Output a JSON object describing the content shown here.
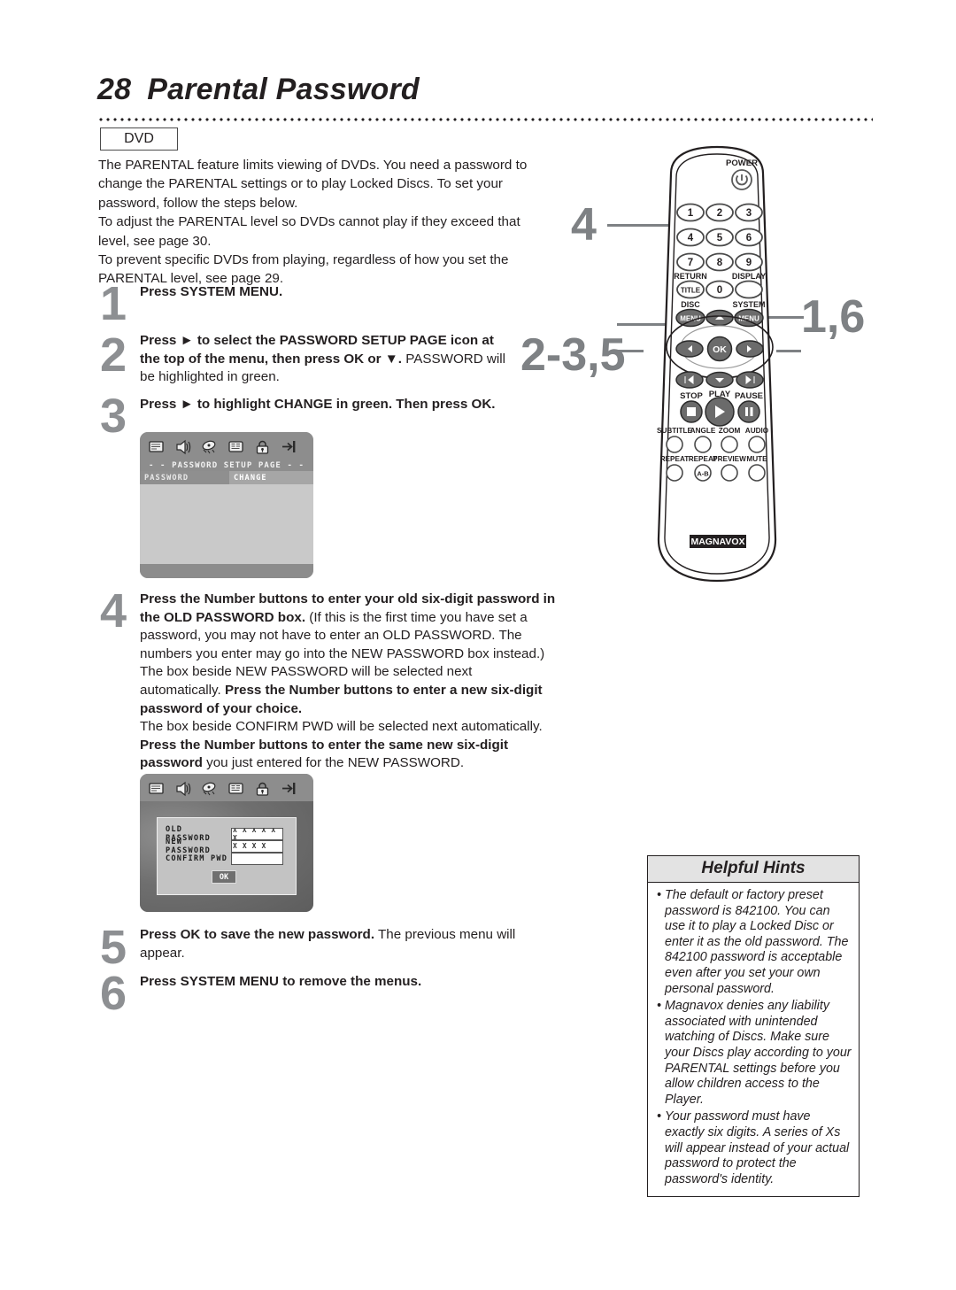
{
  "page": {
    "number": "28",
    "title": "Parental Password",
    "media_badge": "DVD"
  },
  "intro": {
    "p1": "The PARENTAL feature limits viewing of DVDs.  You need a password to change the PARENTAL settings or to play Locked Discs. To set your password, follow the steps below.",
    "p2": "To adjust the PARENTAL level so DVDs cannot play if they exceed that level, see page 30.",
    "p3": "To prevent specific DVDs from playing, regardless of how you set the PARENTAL level, see page 29."
  },
  "steps": [
    {
      "num": "1",
      "html": "<b>Press SYSTEM MENU.</b>"
    },
    {
      "num": "2",
      "html": "<b>Press &#9658; to select the PASSWORD SETUP PAGE icon at the top of the menu, then press OK or &#9660;.</b> PASSWORD will be highlighted in green."
    },
    {
      "num": "3",
      "html": "<b>Press &#9658; to highlight CHANGE in green. Then press OK.</b>"
    },
    {
      "num": "4",
      "html": "<b>Press the Number buttons to enter your old six-digit password in the OLD PASSWORD box.</b> (If this is the first time you have set a password, you may not have to enter an OLD PASSWORD. The numbers you enter may go into the NEW PASSWORD box instead.)<br>The box beside NEW PASSWORD will be selected next automatically. <b>Press the Number buttons to enter a new six-digit password of your choice.</b><br>The box beside CONFIRM PWD will be selected next automatically. <b>Press the Number buttons to enter the same new six-digit password</b> you just entered for the NEW PASSWORD."
    },
    {
      "num": "5",
      "html": "<b>Press OK to save the new password.</b>  The previous menu will appear."
    },
    {
      "num": "6",
      "html": "<b>Press SYSTEM MENU to remove the menus.</b>"
    }
  ],
  "osd_screen_1": {
    "icons": [
      "general-setup-icon",
      "audio-setup-icon",
      "video-setup-icon",
      "preference-setup-icon",
      "password-setup-icon",
      "exit-setup-icon"
    ],
    "title": "- -  PASSWORD  SETUP  PAGE  - -",
    "rows": [
      {
        "label": "PASSWORD",
        "value": "CHANGE"
      }
    ]
  },
  "osd_screen_2": {
    "icons": [
      "general-setup-icon",
      "audio-setup-icon",
      "video-setup-icon",
      "preference-setup-icon",
      "password-setup-icon",
      "exit-setup-icon"
    ],
    "fields": [
      {
        "label": "OLD PASSWORD",
        "value": "X X X X X X"
      },
      {
        "label": "NEW PASSWORD",
        "value": "X X X X"
      },
      {
        "label": "CONFIRM PWD",
        "value": ""
      }
    ],
    "ok_label": "OK"
  },
  "hints": {
    "heading": "Helpful Hints",
    "items": [
      "The default or factory preset password is 842100. You can use it to play a Locked Disc or enter it as the old password. The 842100 password is acceptable even after you set your own personal password.",
      "Magnavox denies any liability associated with unintended watching of Discs. Make sure your Discs play according to your PARENTAL settings before you allow children access to the Player.",
      "Your password must have exactly six digits. A series of Xs will appear instead of your actual password to protect the password's identity."
    ]
  },
  "callouts": {
    "number_pad": "4",
    "arrows_ok": "2-3,5",
    "system_menu": "1,6"
  },
  "remote": {
    "brand": "MAGNAVOX",
    "power_label": "POWER",
    "number_keys": [
      "1",
      "2",
      "3",
      "4",
      "5",
      "6",
      "7",
      "8",
      "9",
      "0"
    ],
    "return_label": "RETURN",
    "title_label": "TITLE",
    "display_label": "DISPLAY",
    "disc_label": "DISC",
    "disc_menu_label": "MENU",
    "system_label": "SYSTEM",
    "system_menu_label": "MENU",
    "ok_label": "OK",
    "stop_label": "STOP",
    "play_label": "PLAY",
    "pause_label": "PAUSE",
    "row_a": [
      "SUBTITLE",
      "ANGLE",
      "ZOOM",
      "AUDIO"
    ],
    "row_b": [
      "REPEAT",
      "REPEAT",
      "PREVIEW",
      "MUTE"
    ],
    "repeat_ab_label": "A-B"
  },
  "colors": {
    "step_number": "#8d8f92",
    "callout": "#7e8184",
    "text": "#231f20",
    "hints_header_bg": "#e3e3e3"
  }
}
